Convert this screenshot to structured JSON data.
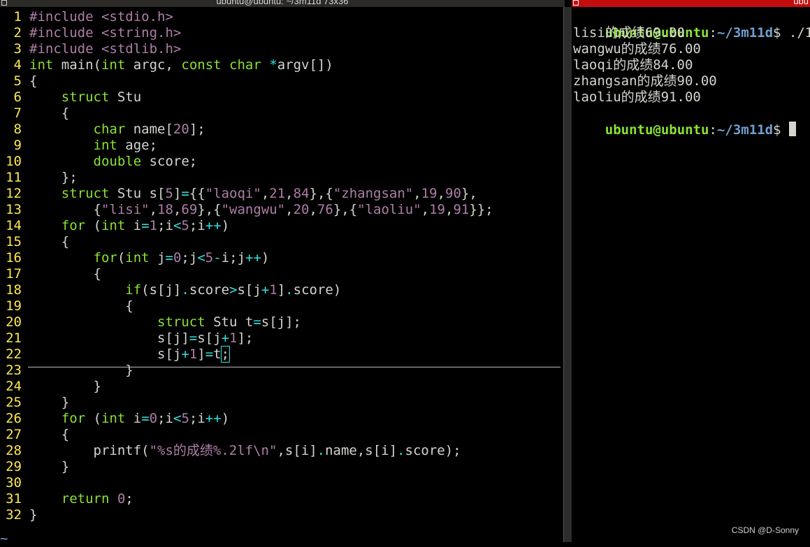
{
  "left_window": {
    "title": "ubuntu@ubuntu: ~/3m11d 73x36"
  },
  "editor": {
    "lines": [
      {
        "n": "1",
        "tokens": [
          [
            "pp",
            "#include"
          ],
          [
            "txt",
            " "
          ],
          [
            "pp",
            "<stdio.h>"
          ]
        ]
      },
      {
        "n": "2",
        "tokens": [
          [
            "pp",
            "#include"
          ],
          [
            "txt",
            " "
          ],
          [
            "pp",
            "<string.h>"
          ]
        ]
      },
      {
        "n": "3",
        "tokens": [
          [
            "pp",
            "#include"
          ],
          [
            "txt",
            " "
          ],
          [
            "pp",
            "<stdlib.h>"
          ]
        ]
      },
      {
        "n": "4",
        "tokens": [
          [
            "ty",
            "int"
          ],
          [
            "txt",
            " main("
          ],
          [
            "ty",
            "int"
          ],
          [
            "txt",
            " argc, "
          ],
          [
            "ty",
            "const"
          ],
          [
            "txt",
            " "
          ],
          [
            "ty",
            "char"
          ],
          [
            "txt",
            " "
          ],
          [
            "op",
            "*"
          ],
          [
            "txt",
            "argv[])"
          ]
        ]
      },
      {
        "n": "5",
        "tokens": [
          [
            "txt",
            "{"
          ]
        ]
      },
      {
        "n": "6",
        "tokens": [
          [
            "txt",
            "    "
          ],
          [
            "ty",
            "struct"
          ],
          [
            "txt",
            " Stu"
          ]
        ]
      },
      {
        "n": "7",
        "tokens": [
          [
            "txt",
            "    {"
          ]
        ]
      },
      {
        "n": "8",
        "tokens": [
          [
            "txt",
            "        "
          ],
          [
            "ty",
            "char"
          ],
          [
            "txt",
            " name["
          ],
          [
            "num",
            "20"
          ],
          [
            "txt",
            "];"
          ]
        ]
      },
      {
        "n": "9",
        "tokens": [
          [
            "txt",
            "        "
          ],
          [
            "ty",
            "int"
          ],
          [
            "txt",
            " age;"
          ]
        ]
      },
      {
        "n": "10",
        "tokens": [
          [
            "txt",
            "        "
          ],
          [
            "ty",
            "double"
          ],
          [
            "txt",
            " score;"
          ]
        ]
      },
      {
        "n": "11",
        "tokens": [
          [
            "txt",
            "    };"
          ]
        ]
      },
      {
        "n": "12",
        "tokens": [
          [
            "txt",
            "    "
          ],
          [
            "ty",
            "struct"
          ],
          [
            "txt",
            " Stu s["
          ],
          [
            "num",
            "5"
          ],
          [
            "txt",
            "]"
          ],
          [
            "op",
            "="
          ],
          [
            "txt",
            "{{"
          ],
          [
            "str",
            "\"laoqi\""
          ],
          [
            "txt",
            ","
          ],
          [
            "num",
            "21"
          ],
          [
            "txt",
            ","
          ],
          [
            "num",
            "84"
          ],
          [
            "txt",
            "},{"
          ],
          [
            "str",
            "\"zhangsan\""
          ],
          [
            "txt",
            ","
          ],
          [
            "num",
            "19"
          ],
          [
            "txt",
            ","
          ],
          [
            "num",
            "90"
          ],
          [
            "txt",
            "},"
          ]
        ]
      },
      {
        "n": "13",
        "tokens": [
          [
            "txt",
            "        {"
          ],
          [
            "str",
            "\"lisi\""
          ],
          [
            "txt",
            ","
          ],
          [
            "num",
            "18"
          ],
          [
            "txt",
            ","
          ],
          [
            "num",
            "69"
          ],
          [
            "txt",
            "},{"
          ],
          [
            "str",
            "\"wangwu\""
          ],
          [
            "txt",
            ","
          ],
          [
            "num",
            "20"
          ],
          [
            "txt",
            ","
          ],
          [
            "num",
            "76"
          ],
          [
            "txt",
            "},{"
          ],
          [
            "str",
            "\"laoliu\""
          ],
          [
            "txt",
            ","
          ],
          [
            "num",
            "19"
          ],
          [
            "txt",
            ","
          ],
          [
            "num",
            "91"
          ],
          [
            "txt",
            "}};"
          ]
        ]
      },
      {
        "n": "14",
        "tokens": [
          [
            "txt",
            "    "
          ],
          [
            "kw",
            "for"
          ],
          [
            "txt",
            " ("
          ],
          [
            "ty",
            "int"
          ],
          [
            "txt",
            " i"
          ],
          [
            "op",
            "="
          ],
          [
            "num",
            "1"
          ],
          [
            "txt",
            ";i"
          ],
          [
            "op",
            "<"
          ],
          [
            "num",
            "5"
          ],
          [
            "txt",
            ";i"
          ],
          [
            "op",
            "++"
          ],
          [
            "txt",
            ")"
          ]
        ]
      },
      {
        "n": "15",
        "tokens": [
          [
            "txt",
            "    {"
          ]
        ]
      },
      {
        "n": "16",
        "tokens": [
          [
            "txt",
            "        "
          ],
          [
            "kw",
            "for"
          ],
          [
            "txt",
            "("
          ],
          [
            "ty",
            "int"
          ],
          [
            "txt",
            " j"
          ],
          [
            "op",
            "="
          ],
          [
            "num",
            "0"
          ],
          [
            "txt",
            ";j"
          ],
          [
            "op",
            "<"
          ],
          [
            "num",
            "5"
          ],
          [
            "op",
            "-"
          ],
          [
            "txt",
            "i;j"
          ],
          [
            "op",
            "++"
          ],
          [
            "txt",
            ")"
          ]
        ]
      },
      {
        "n": "17",
        "tokens": [
          [
            "txt",
            "        {"
          ]
        ]
      },
      {
        "n": "18",
        "tokens": [
          [
            "txt",
            "            "
          ],
          [
            "kw",
            "if"
          ],
          [
            "txt",
            "(s[j]"
          ],
          [
            "op",
            "."
          ],
          [
            "txt",
            "score"
          ],
          [
            "op",
            ">"
          ],
          [
            "txt",
            "s[j"
          ],
          [
            "op",
            "+"
          ],
          [
            "num",
            "1"
          ],
          [
            "txt",
            "]"
          ],
          [
            "op",
            "."
          ],
          [
            "txt",
            "score)"
          ]
        ]
      },
      {
        "n": "19",
        "tokens": [
          [
            "txt",
            "            {"
          ]
        ]
      },
      {
        "n": "20",
        "tokens": [
          [
            "txt",
            "                "
          ],
          [
            "ty",
            "struct"
          ],
          [
            "txt",
            " Stu t"
          ],
          [
            "op",
            "="
          ],
          [
            "txt",
            "s[j];"
          ]
        ]
      },
      {
        "n": "21",
        "tokens": [
          [
            "txt",
            "                s[j]"
          ],
          [
            "op",
            "="
          ],
          [
            "txt",
            "s[j"
          ],
          [
            "op",
            "+"
          ],
          [
            "num",
            "1"
          ],
          [
            "txt",
            "];"
          ]
        ]
      },
      {
        "n": "22",
        "tokens": [
          [
            "txt",
            "                s[j"
          ],
          [
            "op",
            "+"
          ],
          [
            "num",
            "1"
          ],
          [
            "txt",
            "]"
          ],
          [
            "op",
            "="
          ],
          [
            "txt",
            "t"
          ],
          [
            "cur",
            ";"
          ]
        ]
      },
      {
        "n": "23",
        "tokens": [
          [
            "txt",
            "            }"
          ]
        ]
      },
      {
        "n": "24",
        "tokens": [
          [
            "txt",
            "        }"
          ]
        ]
      },
      {
        "n": "25",
        "tokens": [
          [
            "txt",
            "    }"
          ]
        ]
      },
      {
        "n": "26",
        "tokens": [
          [
            "txt",
            "    "
          ],
          [
            "kw",
            "for"
          ],
          [
            "txt",
            " ("
          ],
          [
            "ty",
            "int"
          ],
          [
            "txt",
            " i"
          ],
          [
            "op",
            "="
          ],
          [
            "num",
            "0"
          ],
          [
            "txt",
            ";i"
          ],
          [
            "op",
            "<"
          ],
          [
            "num",
            "5"
          ],
          [
            "txt",
            ";i"
          ],
          [
            "op",
            "++"
          ],
          [
            "txt",
            ")"
          ]
        ]
      },
      {
        "n": "27",
        "tokens": [
          [
            "txt",
            "    {"
          ]
        ]
      },
      {
        "n": "28",
        "tokens": [
          [
            "txt",
            "        printf("
          ],
          [
            "str",
            "\"%s的成绩%.2lf\\n\""
          ],
          [
            "txt",
            ",s[i]"
          ],
          [
            "op",
            "."
          ],
          [
            "txt",
            "name,s[i]"
          ],
          [
            "op",
            "."
          ],
          [
            "txt",
            "score);"
          ]
        ]
      },
      {
        "n": "29",
        "tokens": [
          [
            "txt",
            "    }"
          ]
        ]
      },
      {
        "n": "30",
        "tokens": []
      },
      {
        "n": "31",
        "tokens": [
          [
            "txt",
            "    "
          ],
          [
            "kw",
            "return"
          ],
          [
            "txt",
            " "
          ],
          [
            "num",
            "0"
          ],
          [
            "txt",
            ";"
          ]
        ]
      },
      {
        "n": "32",
        "tokens": [
          [
            "txt",
            "}"
          ]
        ]
      }
    ],
    "tilde": "~"
  },
  "right_window": {
    "title": "ubu"
  },
  "terminal": {
    "prompt_user": "ubuntu@ubuntu",
    "prompt_sep": ":",
    "prompt_path": "~/3m11d",
    "prompt_dollar": "$",
    "command": " ./1",
    "output": [
      "lisi的成绩69.00",
      "wangwu的成绩76.00",
      "laoqi的成绩84.00",
      "zhangsan的成绩90.00",
      "laoliu的成绩91.00"
    ]
  },
  "watermark": "CSDN @D-Sonny",
  "colors": {
    "keyword": "#8ae234",
    "line_number": "#fce94f",
    "string": "#ad7fa8",
    "operator": "#34e2e2",
    "prompt_user": "#8ae234",
    "prompt_path": "#729fcf",
    "right_title_bg": "#c40d0d"
  }
}
